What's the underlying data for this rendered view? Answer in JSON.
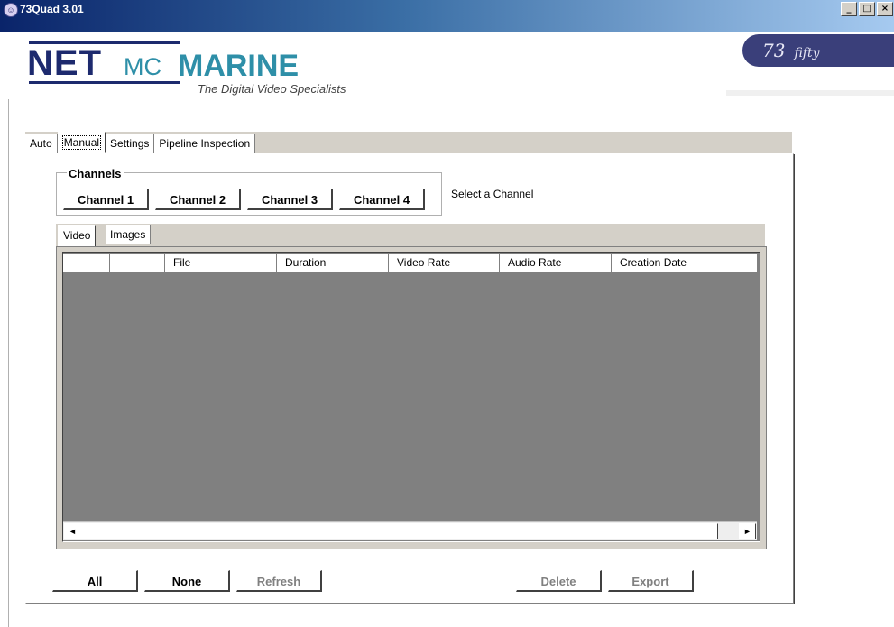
{
  "window": {
    "title": "73Quad 3.01",
    "controls": [
      "_",
      "□",
      "×"
    ]
  },
  "brand": {
    "logo_net": "NET",
    "logo_mc": "MC",
    "logo_marine": "MARINE",
    "tagline": "The Digital Video Specialists",
    "badge_main": "73",
    "badge_sub": "fifty"
  },
  "main_tabs": [
    {
      "label": "Auto"
    },
    {
      "label": "Manual"
    },
    {
      "label": "Settings"
    },
    {
      "label": "Pipeline Inspection"
    }
  ],
  "active_main_tab": "Manual",
  "channels": {
    "legend": "Channels",
    "buttons": [
      "Channel 1",
      "Channel 2",
      "Channel 3",
      "Channel 4"
    ],
    "status": "Select a Channel"
  },
  "sub_tabs": [
    {
      "label": "Video"
    },
    {
      "label": "Images"
    }
  ],
  "active_sub_tab": "Video",
  "table": {
    "columns": [
      "",
      "",
      "File",
      "Duration",
      "Video Rate",
      "Audio Rate",
      "Creation Date"
    ],
    "rows": []
  },
  "scrollbar": {
    "left_arrow": "◄",
    "right_arrow": "►"
  },
  "actions": {
    "all": "All",
    "none": "None",
    "refresh": "Refresh",
    "delete": "Delete",
    "export": "Export"
  }
}
